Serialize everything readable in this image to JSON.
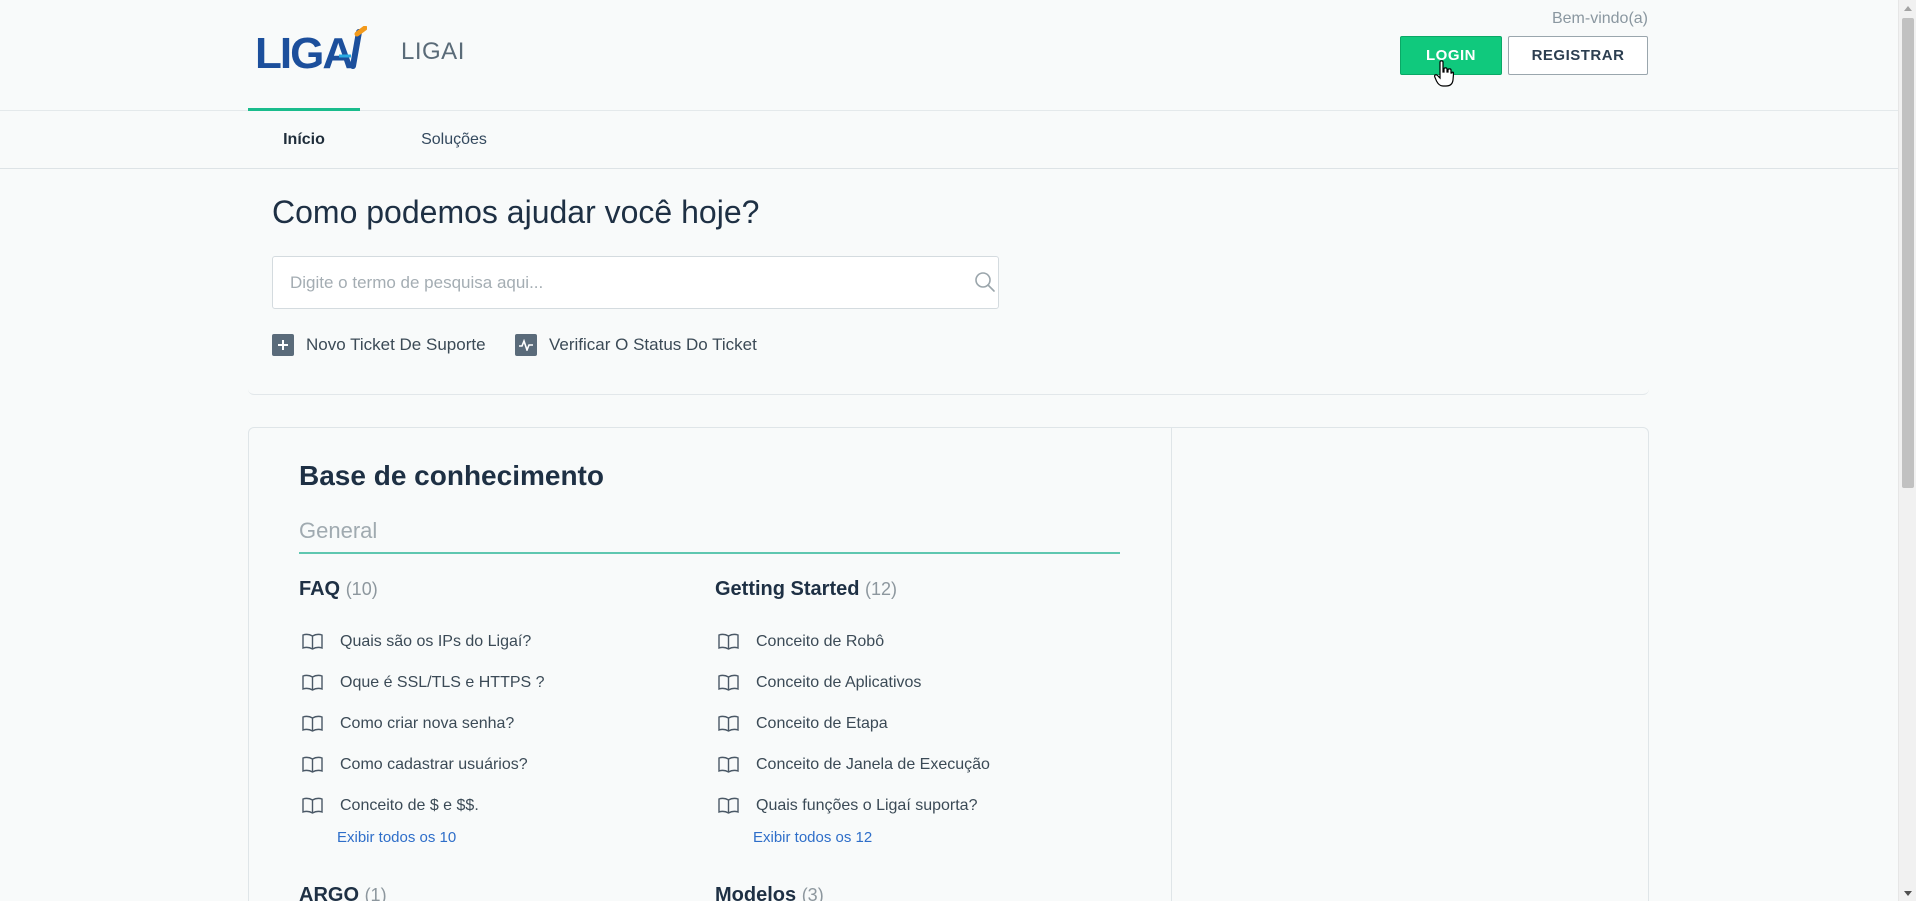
{
  "header": {
    "brand_logo_text": "LIGAÍ",
    "brand_name": "LIGAI",
    "welcome_text": "Bem-vindo(a)",
    "login_label": "LOGIN",
    "register_label": "REGISTRAR"
  },
  "nav": {
    "tabs": [
      {
        "label": "Início",
        "active": true
      },
      {
        "label": "Soluções",
        "active": false
      }
    ]
  },
  "hero": {
    "title": "Como podemos ajudar você hoje?",
    "search_placeholder": "Digite o termo de pesquisa aqui...",
    "search_value": "",
    "new_ticket_label": "Novo Ticket De Suporte",
    "check_status_label": "Verificar O Status Do Ticket"
  },
  "knowledge_base": {
    "title": "Base de conhecimento",
    "category": "General",
    "sections": [
      {
        "title": "FAQ",
        "count": "(10)",
        "articles": [
          "Quais são os IPs do Ligaí?",
          "Oque é SSL/TLS e HTTPS ?",
          "Como criar nova senha?",
          "Como cadastrar usuários?",
          "Conceito de $ e $$."
        ],
        "view_all": "Exibir todos os 10"
      },
      {
        "title": "Getting Started",
        "count": "(12)",
        "articles": [
          "Conceito de Robô",
          "Conceito de Aplicativos",
          "Conceito de Etapa",
          "Conceito de Janela de Execução",
          "Quais funções o Ligaí suporta?"
        ],
        "view_all": "Exibir todos os 12"
      },
      {
        "title": "ARGO",
        "count": "(1)"
      },
      {
        "title": "Modelos",
        "count": "(3)"
      }
    ]
  },
  "colors": {
    "accent_green": "#10c97d",
    "tab_underline": "#1abc8c",
    "link_blue": "#2e6ec9",
    "logo_blue": "#1c4f9c",
    "logo_orange": "#f39a1b"
  }
}
